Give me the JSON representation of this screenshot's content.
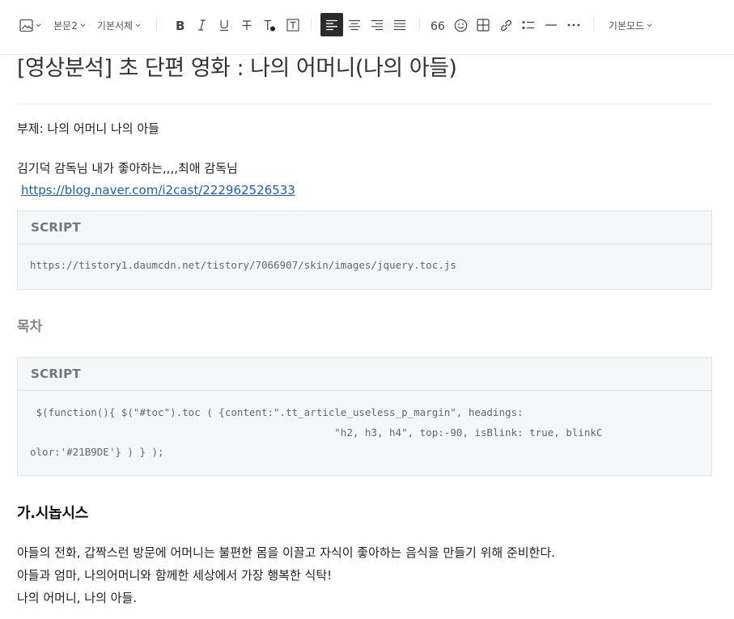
{
  "toolbar": {
    "paragraph_style": "본문2",
    "font": "기본서체",
    "mode": "기본모드"
  },
  "post": {
    "title": "[영상분석] 초 단편 영화 : 나의 어머니(나의 아들)",
    "subtitle": "부제: 나의 어머니 나의 아들",
    "intro": "김기덕 감독님 내가 좋아하는,,,,최애 감독님",
    "link": "https://blog.naver.com/i2cast/222962526533",
    "script1": {
      "header": "SCRIPT",
      "code": "https://tistory1.daumcdn.net/tistory/7066907/skin/images/jquery.toc.js"
    },
    "toc_label": "목차",
    "script2": {
      "header": "SCRIPT",
      "line1": " $(function(){ $(\"#toc\").toc ( {content:\".tt_article_useless_p_margin\", headings:",
      "line2": "                                                  \"h2, h3, h4\", top:-90, isBlink: true, blinkC",
      "line3": "olor:'#21B9DE'} ) } );"
    },
    "section_heading": "가.시놉시스",
    "synopsis": [
      "아들의 전화, 갑짝스런 방문에 어머니는 불편한 몸을 이끌고 자식이 좋아하는 음식을 만들기 위해 준비한다.",
      "아들과 엄마, 나의어머니와 함께한 세상에서 가장 행복한 식탁!",
      "나의 어머니, 나의 아들."
    ]
  },
  "colors": {
    "link": "#1a5fb4",
    "script_bg": "#f5f6f8",
    "active_tool": "#2b2b2b"
  }
}
